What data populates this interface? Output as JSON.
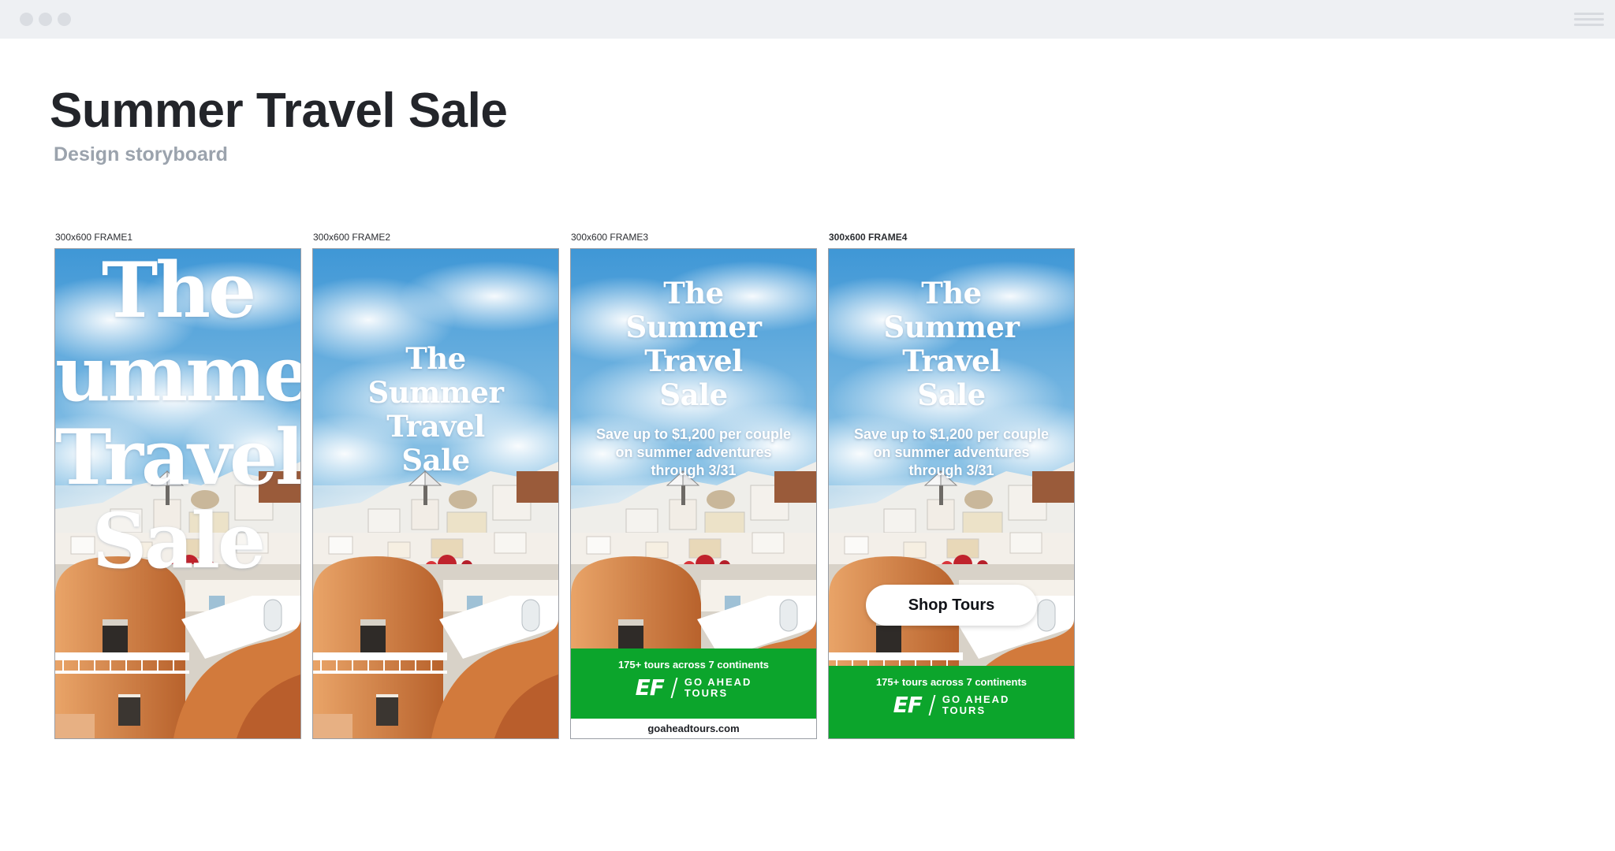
{
  "window": {
    "controls": [
      "close",
      "minimize",
      "maximize"
    ],
    "menu_icon": "hamburger-menu-icon"
  },
  "page": {
    "title": "Summer Travel Sale",
    "subtitle": "Design storyboard"
  },
  "headline_lines": [
    "The",
    "Summer",
    "Travel",
    "Sale"
  ],
  "frame1_big_lines": [
    "The",
    "umme",
    "Travel",
    "Sale"
  ],
  "frames": [
    {
      "label": "300x600 FRAME1"
    },
    {
      "label": "300x600 FRAME2"
    },
    {
      "label": "300x600 FRAME3",
      "offer": [
        "Save up to $1,200 per couple",
        "on summer adventures",
        "through 3/31"
      ],
      "tours": "175+ tours across 7 continents",
      "logo_mark": "EF",
      "logo_text": [
        "GO AHEAD",
        "TOURS"
      ],
      "url": "goaheadtours.com"
    },
    {
      "label": "300x600 FRAME4",
      "offer": [
        "Save up to $1,200 per couple",
        "on summer adventures",
        "through 3/31"
      ],
      "cta": "Shop Tours",
      "tours": "175+ tours across 7 continents",
      "logo_mark": "EF",
      "logo_text": [
        "GO AHEAD",
        "TOURS"
      ]
    }
  ],
  "colors": {
    "brand_green": "#0ca52c",
    "sky": "#5ea9da",
    "terracotta": "#d07a3f",
    "title": "#23252a",
    "subtitle": "#9ba3ad"
  }
}
